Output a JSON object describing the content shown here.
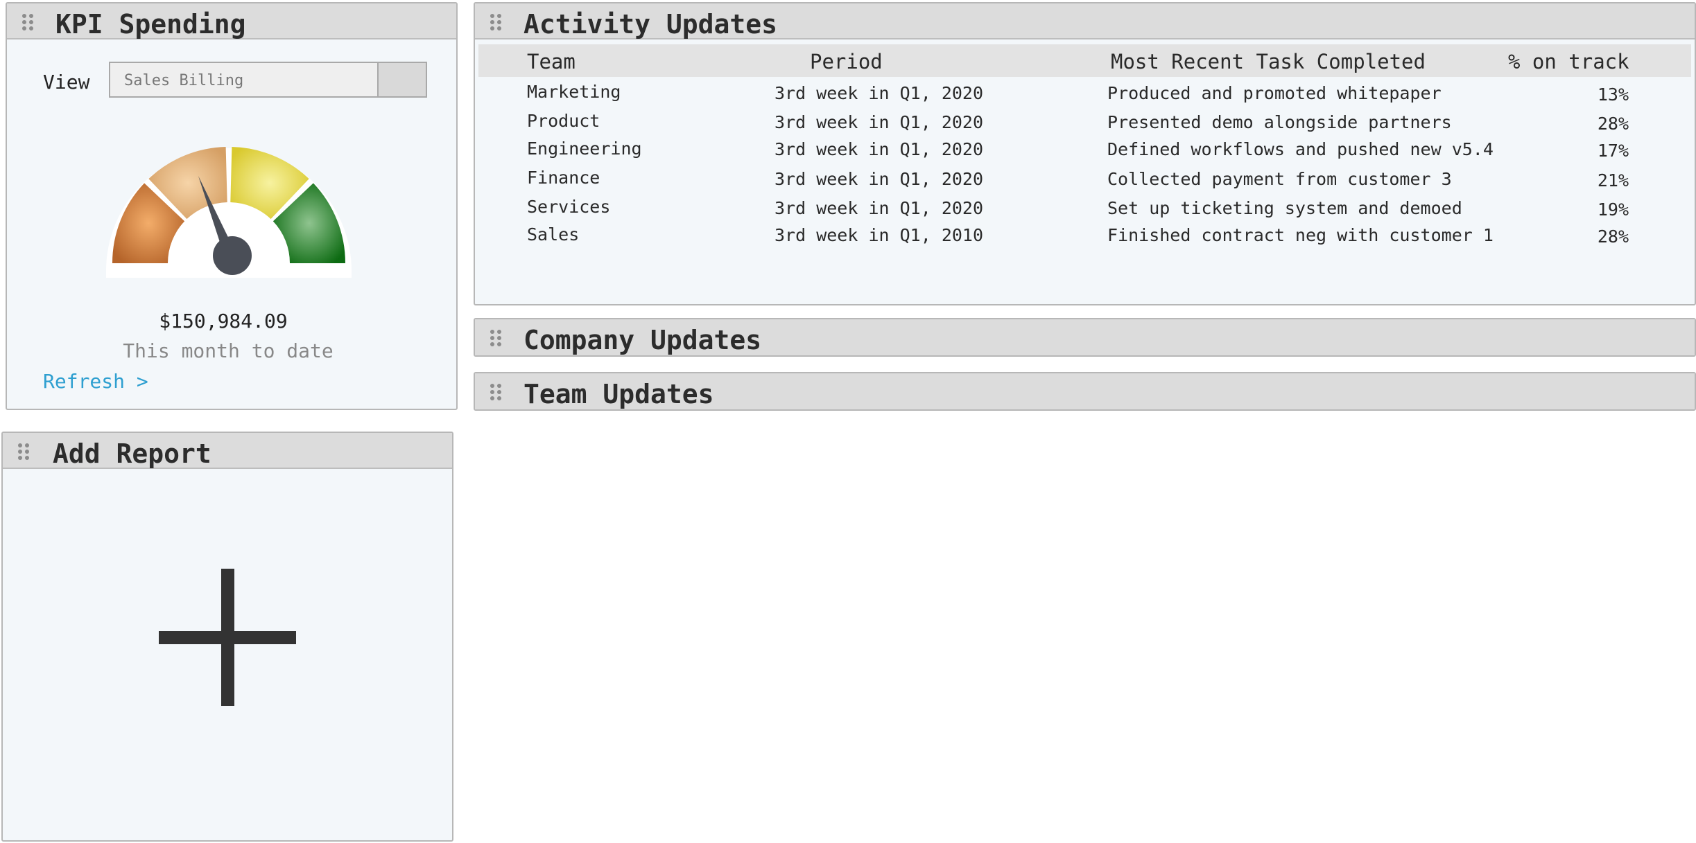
{
  "kpi": {
    "title": "KPI Spending",
    "view_label": "View",
    "select_value": "Sales Billing",
    "amount": "$150,984.09",
    "subtext": "This month to date",
    "refresh_label": "Refresh >"
  },
  "add_report": {
    "title": "Add Report"
  },
  "activity": {
    "title": "Activity Updates",
    "columns": [
      "Team",
      "Period",
      "Most Recent Task Completed",
      "% on track"
    ],
    "rows": [
      {
        "team": "Marketing",
        "period": "3rd week in Q1, 2020",
        "task": "Produced and promoted whitepaper",
        "pct": "13%"
      },
      {
        "team": "Product",
        "period": "3rd week in Q1, 2020",
        "task": "Presented demo alongside partners",
        "pct": "28%"
      },
      {
        "team": "Engineering",
        "period": "3rd week in Q1, 2020",
        "task": "Defined workflows and pushed new v5.4",
        "pct": "17%"
      },
      {
        "team": "Finance",
        "period": "3rd week in Q1, 2020",
        "task": "Collected payment from customer 3",
        "pct": "21%"
      },
      {
        "team": "Services",
        "period": "3rd week in Q1, 2020",
        "task": "Set up ticketing system and demoed",
        "pct": "19%"
      },
      {
        "team": "Sales",
        "period": "3rd week in Q1, 2010",
        "task": "Finished contract neg with customer 1",
        "pct": "28%"
      }
    ]
  },
  "company_updates": {
    "title": "Company Updates"
  },
  "team_updates": {
    "title": "Team Updates"
  },
  "colors": {
    "header_bg": "#dcdcdc",
    "panel_bg": "#f3f7fa",
    "link": "#2e9fd0",
    "gauge_orange": "#c8783a",
    "gauge_tan": "#e0b17c",
    "gauge_yellow": "#e6da4a",
    "gauge_green": "#1b7a1f",
    "needle": "#4a4e57"
  },
  "icons": {
    "grip": "drag-handle-icon",
    "plus": "plus-icon",
    "gauge": "gauge-icon"
  }
}
